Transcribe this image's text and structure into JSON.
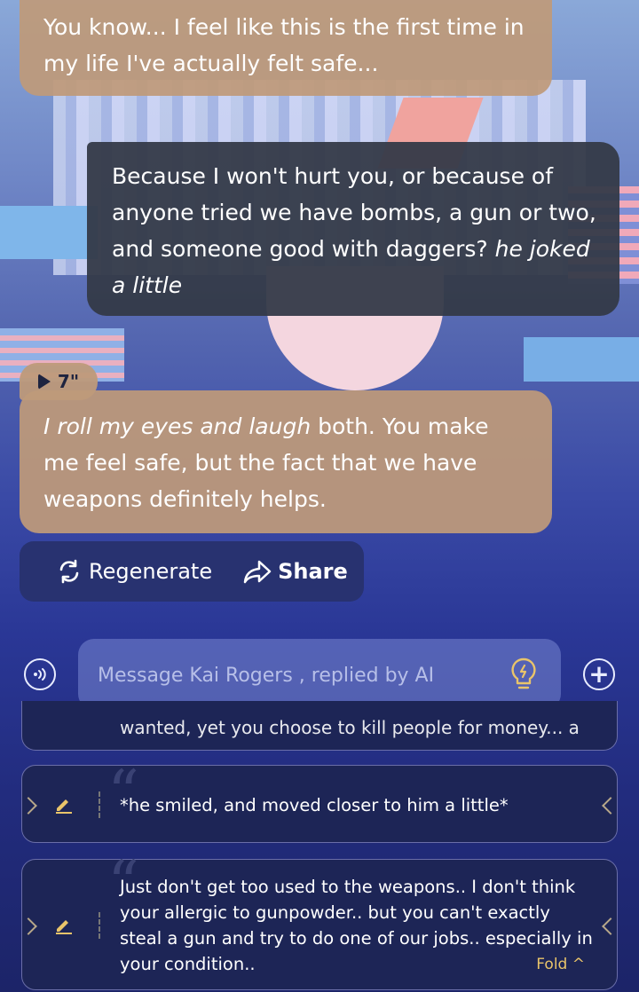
{
  "messages": [
    {
      "role": "ai",
      "text": "You know... I feel like this is the first time in my life I've actually felt safe..."
    },
    {
      "role": "user",
      "text": "Because I won't hurt you, or because of anyone tried we have bombs, a gun or two, and someone good with daggers?",
      "italic": "he joked a little"
    },
    {
      "role": "ai",
      "italic": "I roll my eyes and laugh",
      "text": "both. You make me feel safe, but the fact that we have weapons definitely helps."
    }
  ],
  "voice_badge": {
    "duration": "7\""
  },
  "actions": {
    "regenerate": "Regenerate",
    "share": "Share"
  },
  "composer": {
    "placeholder": "Message Kai Rogers , replied by AI"
  },
  "cards": {
    "partial_text": "wanted, yet you choose to kill people for money... a",
    "items": [
      {
        "text": "*he smiled, and moved closer to him a little*"
      },
      {
        "text": "Just don't get too used to the weapons.. I don't think your allergic to gunpowder.. but you can't exactly steal a gun and try to do one of our jobs.. especially in your condition..",
        "fold_label": "Fold"
      }
    ]
  },
  "colors": {
    "ai_bubble": "#be9a7a",
    "user_bubble": "#343a48",
    "accent": "#e9c46a"
  }
}
